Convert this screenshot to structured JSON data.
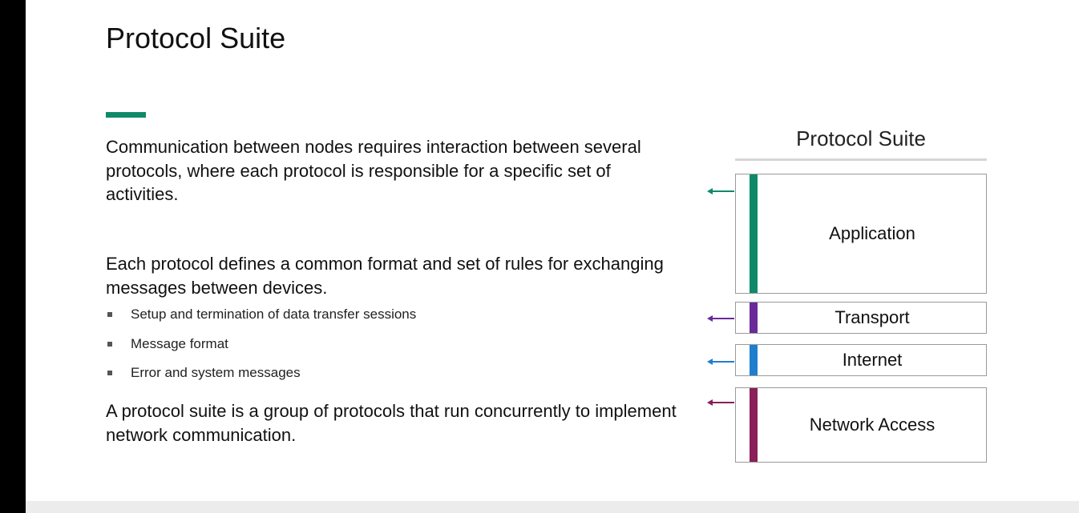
{
  "slide": {
    "title": "Protocol Suite",
    "paragraph_1": "Communication between nodes requires interaction between several protocols, where each protocol is responsible for a specific set of activities.",
    "paragraph_2": "Each protocol defines a common format and set of rules for exchanging messages between devices.",
    "bullets": [
      "Setup and termination of data transfer sessions",
      "Message format",
      "Error and system messages"
    ],
    "paragraph_3": "A protocol suite is a group of protocols that run concurrently to implement network communication."
  },
  "diagram": {
    "title": "Protocol Suite",
    "layers": [
      {
        "label": "Application",
        "color": "#0f8a68"
      },
      {
        "label": "Transport",
        "color": "#6a2a9a"
      },
      {
        "label": "Internet",
        "color": "#1f7fcf"
      },
      {
        "label": "Network Access",
        "color": "#8a1f5a"
      }
    ]
  },
  "theme": {
    "accent": "#0f8a68"
  }
}
